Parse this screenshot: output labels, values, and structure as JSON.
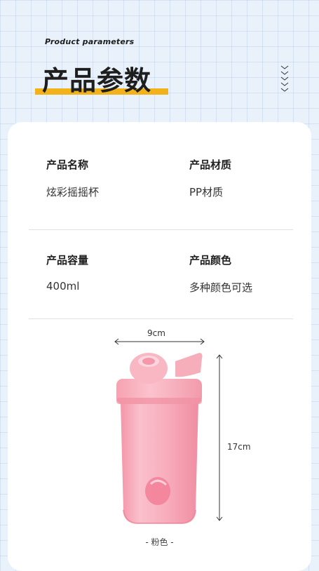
{
  "header": {
    "subtitle": "Product parameters",
    "title": "产品参数",
    "accent_color": "#f2b31a"
  },
  "params": [
    {
      "label": "产品名称",
      "value": "炫彩摇摇杯"
    },
    {
      "label": "产品材质",
      "value": "PP材质"
    },
    {
      "label": "产品容量",
      "value": "400ml"
    },
    {
      "label": "产品颜色",
      "value": "多种颜色可选"
    }
  ],
  "product": {
    "width_label": "9cm",
    "height_label": "17cm",
    "color_label": "- 粉色 -",
    "bottle_color": "#f7a3b4"
  },
  "icons": {
    "decor": "chevron-down-icon"
  }
}
